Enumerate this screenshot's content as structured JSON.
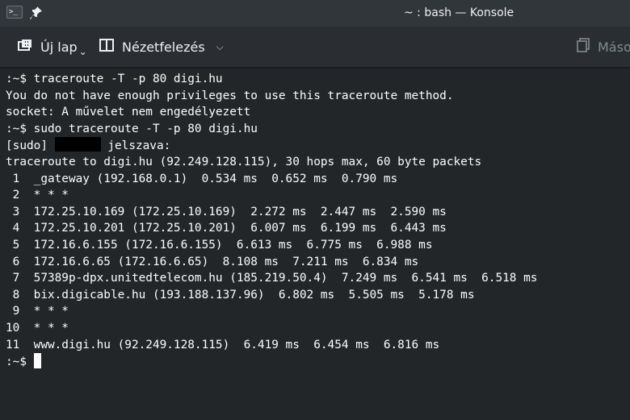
{
  "window": {
    "title": "~ : bash — Konsole",
    "app_icon_text": ">_"
  },
  "toolbar": {
    "new_tab_label": "Új lap",
    "view_label": "Nézetfelezés",
    "copy_label": "Máso"
  },
  "terminal": {
    "lines": [
      ":~$ traceroute -T -p 80 digi.hu",
      "You do not have enough privileges to use this traceroute method.",
      "socket: A művelet nem engedélyezett",
      ":~$ sudo traceroute -T -p 80 digi.hu",
      "[sudo]",
      "traceroute to digi.hu (92.249.128.115), 30 hops max, 60 byte packets",
      " 1  _gateway (192.168.0.1)  0.534 ms  0.652 ms  0.790 ms",
      " 2  * * *",
      " 3  172.25.10.169 (172.25.10.169)  2.272 ms  2.447 ms  2.590 ms",
      " 4  172.25.10.201 (172.25.10.201)  6.007 ms  6.199 ms  6.443 ms",
      " 5  172.16.6.155 (172.16.6.155)  6.613 ms  6.775 ms  6.988 ms",
      " 6  172.16.6.65 (172.16.6.65)  8.108 ms  7.211 ms  6.834 ms",
      " 7  57389p-dpx.unitedtelecom.hu (185.219.50.4)  7.249 ms  6.541 ms  6.518 ms",
      " 8  bix.digicable.hu (193.188.137.96)  6.802 ms  5.505 ms  5.178 ms",
      " 9  * * *",
      "10  * * *",
      "11  www.digi.hu (92.249.128.115)  6.419 ms  6.454 ms  6.816 ms",
      ":~$"
    ],
    "sudo_prompt_suffix": "jelszava:"
  },
  "colors": {
    "background": "#232629",
    "text": "#fcfcfc",
    "titlebar": "#31363b",
    "toolbar": "#2a2e32"
  }
}
